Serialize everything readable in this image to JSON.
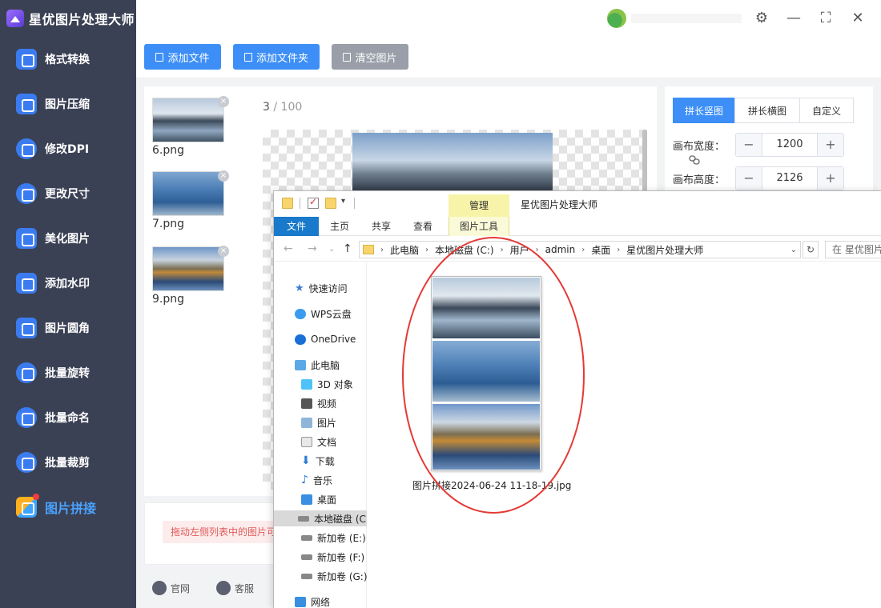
{
  "app": {
    "title": "星优图片处理大师"
  },
  "sidebar": {
    "items": [
      {
        "label": "格式转换",
        "icon": "format-convert-icon"
      },
      {
        "label": "图片压缩",
        "icon": "compress-icon"
      },
      {
        "label": "修改DPI",
        "icon": "dpi-icon"
      },
      {
        "label": "更改尺寸",
        "icon": "resize-icon"
      },
      {
        "label": "美化图片",
        "icon": "beautify-icon"
      },
      {
        "label": "添加水印",
        "icon": "watermark-icon"
      },
      {
        "label": "图片圆角",
        "icon": "round-corner-icon"
      },
      {
        "label": "批量旋转",
        "icon": "rotate-icon"
      },
      {
        "label": "批量命名",
        "icon": "rename-icon"
      },
      {
        "label": "批量裁剪",
        "icon": "crop-icon"
      },
      {
        "label": "图片拼接",
        "icon": "stitch-icon",
        "active": true
      }
    ]
  },
  "window_controls": {
    "settings": "⚙",
    "minimize": "—",
    "maximize": "⛶",
    "close": "✕"
  },
  "toolbar": {
    "add_file": "添加文件",
    "add_folder": "添加文件夹",
    "clear_images": "清空图片"
  },
  "files": [
    {
      "name": "6.png"
    },
    {
      "name": "7.png"
    },
    {
      "name": "9.png"
    }
  ],
  "preview": {
    "current": "3",
    "separator": " / ",
    "total": "100"
  },
  "settings": {
    "tabs": [
      {
        "label": "拼长竖图",
        "active": true
      },
      {
        "label": "拼长横图",
        "active": false
      },
      {
        "label": "自定义",
        "active": false
      }
    ],
    "canvas_width_label": "画布宽度：",
    "canvas_width": "1200",
    "canvas_height_label": "画布高度：",
    "canvas_height": "2126",
    "minus": "−",
    "plus": "+"
  },
  "hint": {
    "text": "拖动左侧列表中的图片可"
  },
  "footer": {
    "website": "官网",
    "service": "客服"
  },
  "explorer": {
    "context_tab": "管理",
    "title": "星优图片处理大师",
    "ribbon_tabs": {
      "file": "文件",
      "home": "主页",
      "share": "共享",
      "view": "查看",
      "picture_tools": "图片工具"
    },
    "breadcrumb": [
      "此电脑",
      "本地磁盘 (C:)",
      "用户",
      "admin",
      "桌面",
      "星优图片处理大师"
    ],
    "search_placeholder": "在 星优图片",
    "nav_tree": {
      "quick_access": "快速访问",
      "wps": "WPS云盘",
      "onedrive": "OneDrive",
      "this_pc": "此电脑",
      "objects_3d": "3D 对象",
      "videos": "视频",
      "pictures": "图片",
      "documents": "文档",
      "downloads": "下载",
      "music": "音乐",
      "desktop": "桌面",
      "local_disk": "本地磁盘 (C",
      "vol_e": "新加卷 (E:)",
      "vol_f": "新加卷 (F:)",
      "vol_g": "新加卷 (G:)",
      "network": "网络"
    },
    "file_item": {
      "name": "图片拼接2024-06-24 11-18-19.jpg"
    }
  }
}
